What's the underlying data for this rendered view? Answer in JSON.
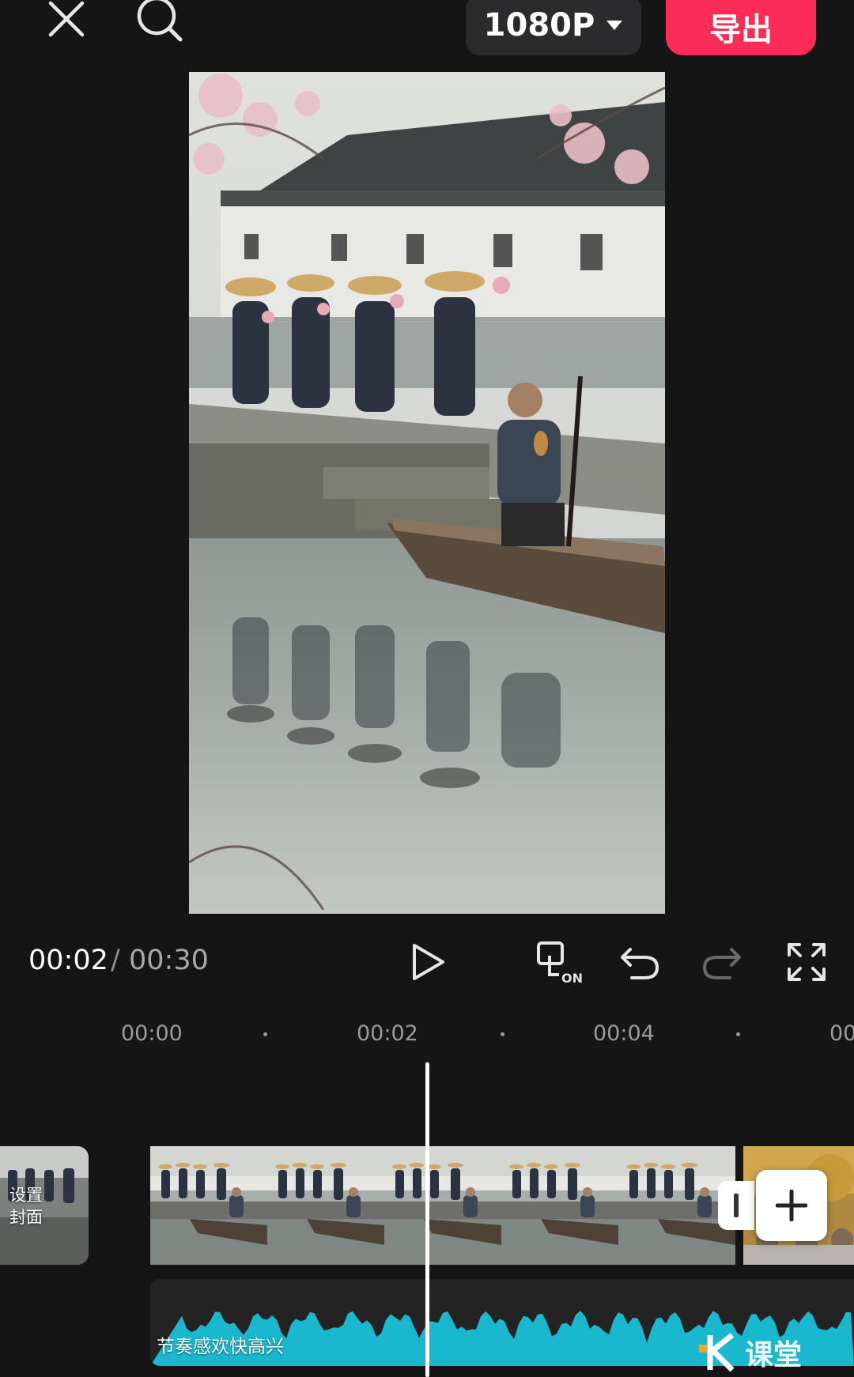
{
  "toolbar": {
    "close_icon": "close-icon",
    "search_icon": "search-icon",
    "resolution": "1080P",
    "export_label": "导出",
    "export_color": "#fb2c55"
  },
  "playback": {
    "current_time": "00:02",
    "separator": "/",
    "total_time": "00:30",
    "sync_badge": "ON"
  },
  "ruler": {
    "labels": [
      "00:00",
      "00:02",
      "00:04",
      "00"
    ]
  },
  "timeline": {
    "cover_label_line1": "设置",
    "cover_label_line2": "封面",
    "audio_label": "节奏感欢快高兴",
    "audio_color": "#19b8cf"
  },
  "watermark": {
    "text": "课堂"
  }
}
